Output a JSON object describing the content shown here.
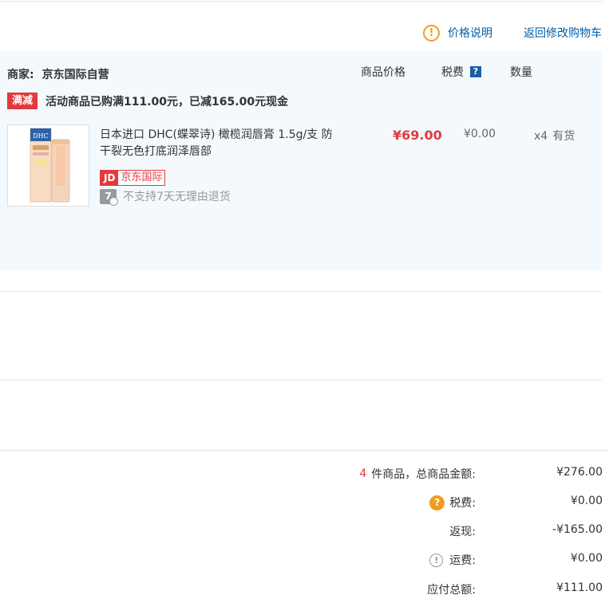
{
  "top_links": {
    "price_note": "价格说明",
    "back_to_cart": "返回修改购物车"
  },
  "icons": {
    "info": "!",
    "help": "?",
    "jd_logo_text": "JD",
    "seven_day": "7"
  },
  "vendor": {
    "label": "商家:",
    "name": "京东国际自营"
  },
  "columns": {
    "price": "商品价格",
    "tax": "税费",
    "qty": "数量"
  },
  "promo": {
    "tag": "满减",
    "text": "活动商品已购满111.00元，已减165.00元现金"
  },
  "product": {
    "title": "日本进口 DHC(蝶翠诗) 橄榄润唇膏 1.5g/支 防干裂无色打底润泽唇部",
    "badge": "京东国际",
    "no_return": "不支持7天无理由退货",
    "price": "¥69.00",
    "tax": "¥0.00",
    "qty": "x4",
    "stock": "有货",
    "image_brand": "DHC"
  },
  "summary": {
    "count": "4",
    "total_label": "件商品，总商品金额:",
    "total_value": "¥276.00",
    "tax_label": "税费:",
    "tax_value": "¥0.00",
    "rebate_label": "返现:",
    "rebate_value": "-¥165.00",
    "shipping_label": "运费:",
    "shipping_value": "¥0.00",
    "payable_label": "应付总额:",
    "payable_value": "¥111.00"
  },
  "colors": {
    "accent_red": "#e4393c",
    "link_blue": "#005ea7",
    "warning_orange": "#f39b1e",
    "panel_bg": "#f3f9fd"
  }
}
